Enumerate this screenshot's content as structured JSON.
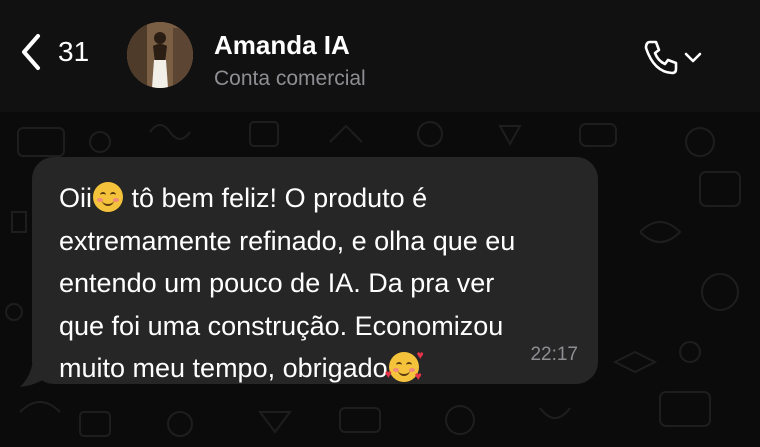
{
  "header": {
    "back_count": "31",
    "contact_name": "Amanda IA",
    "contact_subtitle": "Conta comercial",
    "icons": {
      "back": "chevron-left-icon",
      "call": "phone-icon",
      "dropdown": "chevron-down-icon"
    }
  },
  "message": {
    "line1_a": "Oii",
    "line1_b": " tô bem feliz! O produto é",
    "line2": "extremamente refinado, e olha que eu",
    "line3": "entendo um pouco de IA. Da pra ver",
    "line4": "que foi uma construção. Economizou",
    "line5": "muito meu tempo, obrigado",
    "time": "22:17",
    "emojis": [
      "smiling-face-icon",
      "smiling-face-with-hearts-icon"
    ]
  },
  "colors": {
    "background": "#0b0b0b",
    "header": "#111111",
    "bubble": "#262626",
    "secondary_text": "#8e8e93"
  }
}
